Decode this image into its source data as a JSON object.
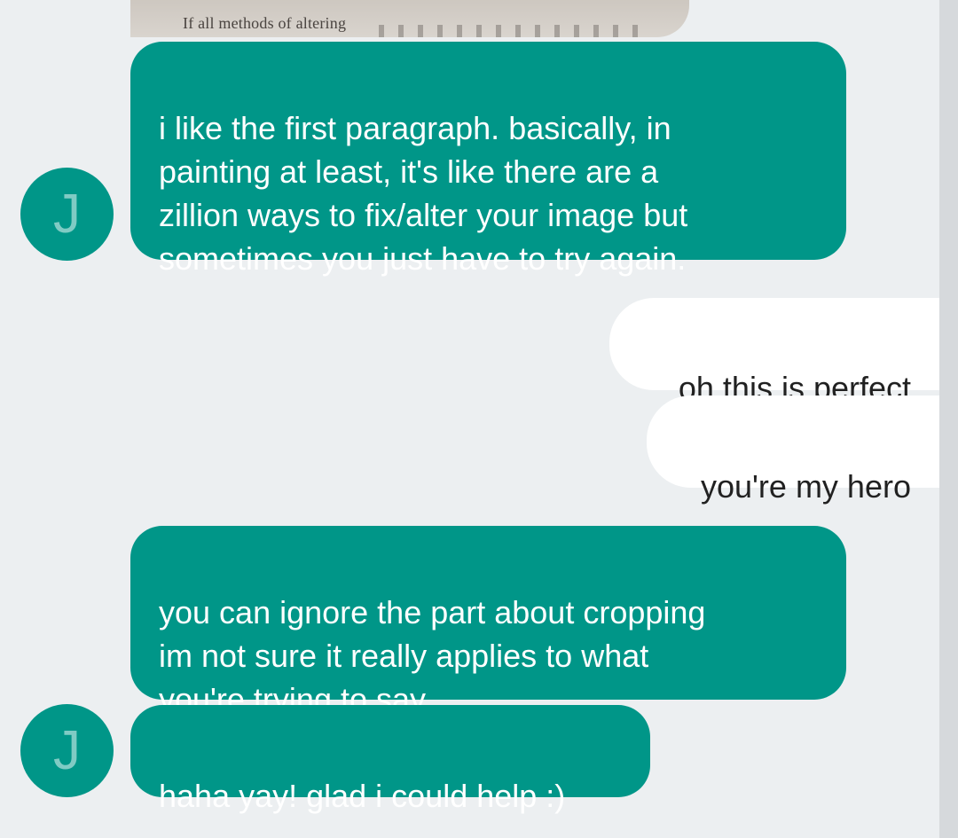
{
  "photo_attachment": {
    "visible_text": "If all methods of altering"
  },
  "contact": {
    "avatar_initial": "J",
    "accent_color": "#009688"
  },
  "messages": [
    {
      "direction": "incoming",
      "text": "i like the first paragraph. basically, in\npainting at least, it's like there are a\nzillion ways to fix/alter your image but\nsometimes you just have to try again."
    },
    {
      "direction": "outgoing",
      "text": "oh this is perfect"
    },
    {
      "direction": "outgoing",
      "text": "you're my hero"
    },
    {
      "direction": "incoming",
      "text": "you can ignore the part about cropping\nim not sure it really applies to what\nyou're trying to say"
    },
    {
      "direction": "incoming",
      "text": "haha yay! glad i could help :)"
    }
  ]
}
